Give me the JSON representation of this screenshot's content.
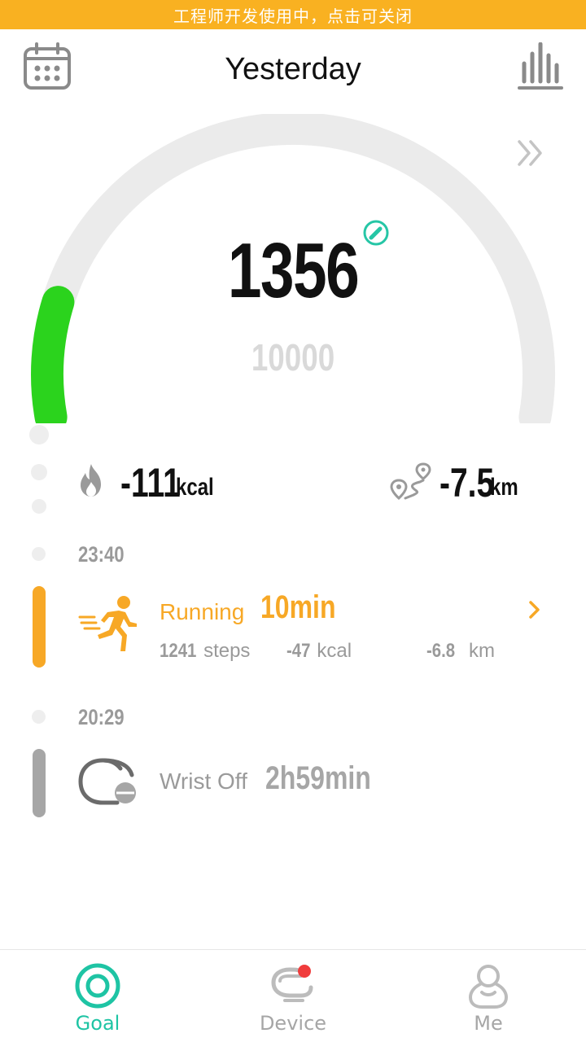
{
  "dev_banner": "工程师开发使用中，点击可关闭",
  "header": {
    "title": "Yesterday"
  },
  "gauge": {
    "steps": "1356",
    "goal": "10000",
    "progress": 0.1356,
    "track_color": "#ebebeb",
    "progress_color": "#2bd31d"
  },
  "summary": {
    "calories_value": "-111",
    "calories_unit": "kcal",
    "distance_value": "-7.5",
    "distance_unit": "km"
  },
  "timeline": [
    {
      "time": "23:40",
      "type": "running",
      "name": "Running",
      "duration": "10min",
      "steps_value": "1241",
      "steps_unit": "steps",
      "kcal_value": "-47",
      "kcal_unit": "kcal",
      "km_value": "-6.8",
      "km_unit": "km",
      "color": "#f7a826"
    },
    {
      "time": "20:29",
      "type": "wrist-off",
      "name": "Wrist Off",
      "duration": "2h59min",
      "color": "#a6a6a6"
    }
  ],
  "tabs": [
    {
      "label": "Goal",
      "active": true,
      "color": "#1ec4a4"
    },
    {
      "label": "Device",
      "active": false,
      "color": "#a6a6a6",
      "badge": true
    },
    {
      "label": "Me",
      "active": false,
      "color": "#a6a6a6"
    }
  ]
}
